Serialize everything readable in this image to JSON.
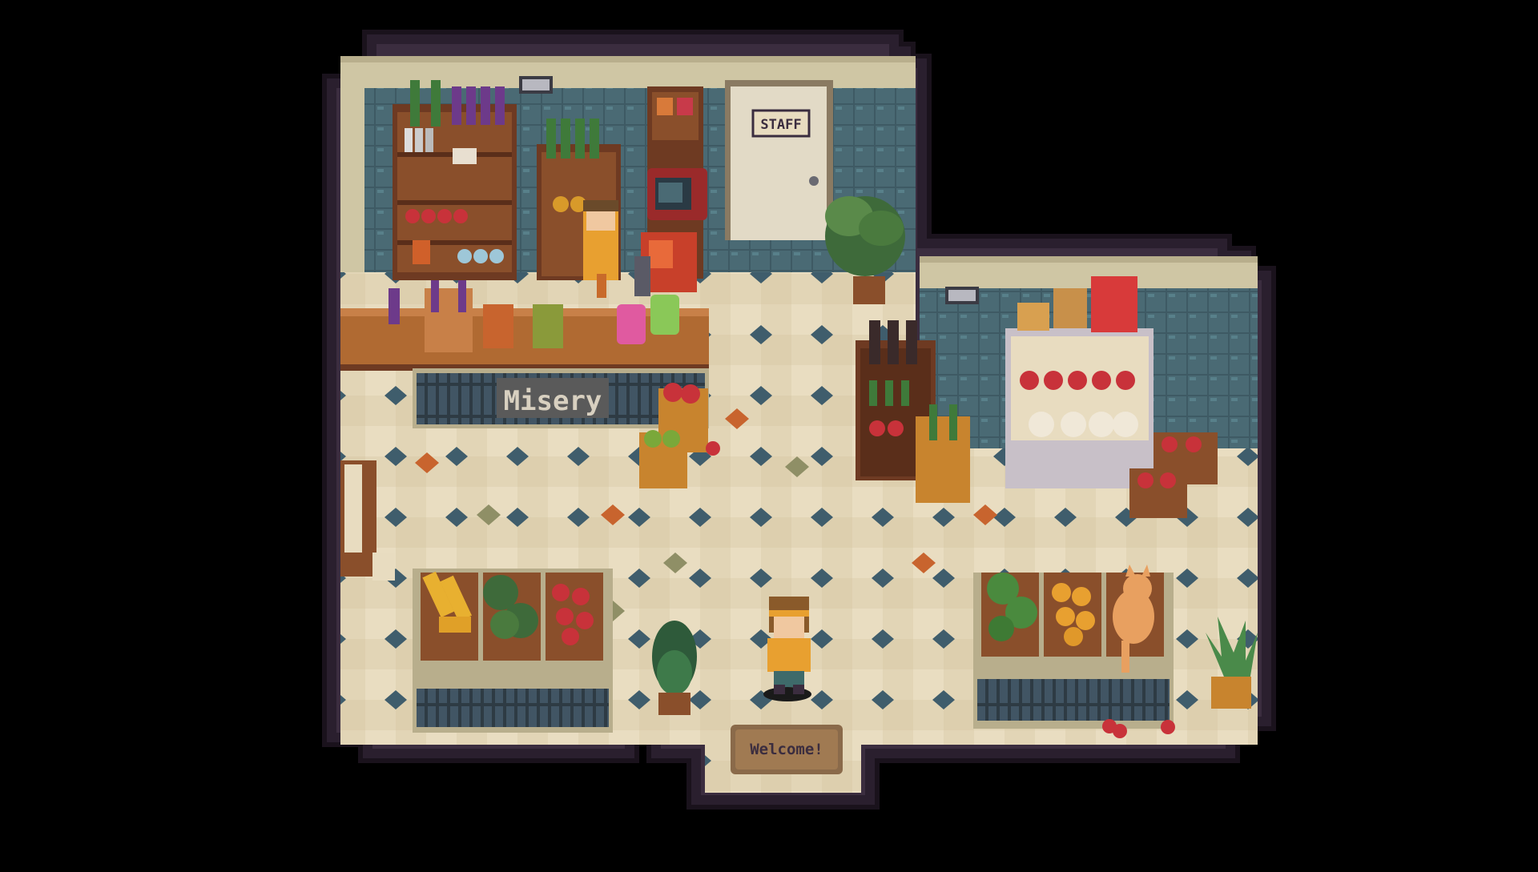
{
  "game": {
    "staff_sign": "STAFF",
    "counter_sign": "Misery",
    "welcome_mat": "Welcome!"
  },
  "colors": {
    "background": "#000000",
    "wall_outline": "#2a1f2e",
    "floor_light": "#e8dcc0",
    "floor_dark": "#d3c5a4",
    "tile_blue": "#3d5c6b",
    "tile_orange": "#c8642e",
    "tile_olive": "#8f8f66",
    "wood": "#8a4f2b",
    "wall_tiles": "#3e5a64"
  },
  "sprites": {
    "player": "player-character",
    "shopkeeper": "shopkeeper-npc",
    "cat": "cat-on-crate",
    "fruit_crates": [
      "bananas",
      "lettuce",
      "apples",
      "cabbage",
      "oranges",
      "tomatoes"
    ]
  }
}
